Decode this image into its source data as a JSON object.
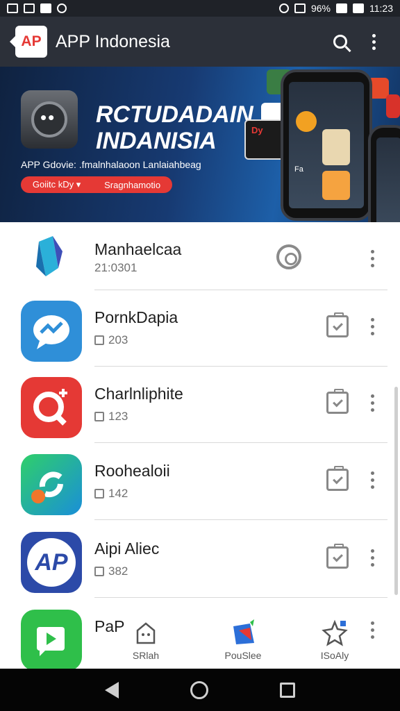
{
  "status_bar": {
    "battery": "96%",
    "time": "11:23"
  },
  "app_bar": {
    "logo_text": "AP",
    "title": "APP Indonesia",
    "icons": [
      "back-icon",
      "search-icon",
      "more-vert-icon"
    ]
  },
  "banner": {
    "title_line1": "RCTUDADAIN",
    "title_line2": "INDANISIA",
    "subtitle": "APP Gdovie: .fmalnhalaoon Lanlaiahbeag",
    "pill_left": "Goiitc kDy ▾",
    "pill_right": "Sragnhamotio",
    "phone_label": "Dy",
    "phone_caption": "Fa"
  },
  "apps": [
    {
      "name": "Manhaelcaa",
      "meta": "21:0301",
      "icon": "kite-icon",
      "color": "#ffffff",
      "action": "target-icon"
    },
    {
      "name": "PornkDapia",
      "meta": "203",
      "icon": "messenger-icon",
      "color": "#2f8fd8",
      "action": "clipboard-check-icon"
    },
    {
      "name": "Charlnliphite",
      "meta": "123",
      "icon": "search-plus-icon",
      "color": "#e53935",
      "action": "clipboard-check-icon"
    },
    {
      "name": "Roohealoii",
      "meta": "142",
      "icon": "refresh-icon",
      "color": "#1fae8f",
      "action": "clipboard-check-icon"
    },
    {
      "name": "Aipi Aliec",
      "meta": "382",
      "icon": "ap-icon",
      "color": "#2c4aa8",
      "action": "clipboard-check-icon"
    },
    {
      "name": "PaP",
      "meta": "",
      "icon": "play-icon",
      "color": "#2fbf4a",
      "action": ""
    }
  ],
  "bottom_nav": [
    {
      "label": "SRlah",
      "icon": "store-icon"
    },
    {
      "label": "PouSlee",
      "icon": "bag-icon"
    },
    {
      "label": "ISoAly",
      "icon": "gear-star-icon"
    }
  ],
  "system_nav": [
    "nav-back-icon",
    "nav-home-icon",
    "nav-recents-icon"
  ]
}
